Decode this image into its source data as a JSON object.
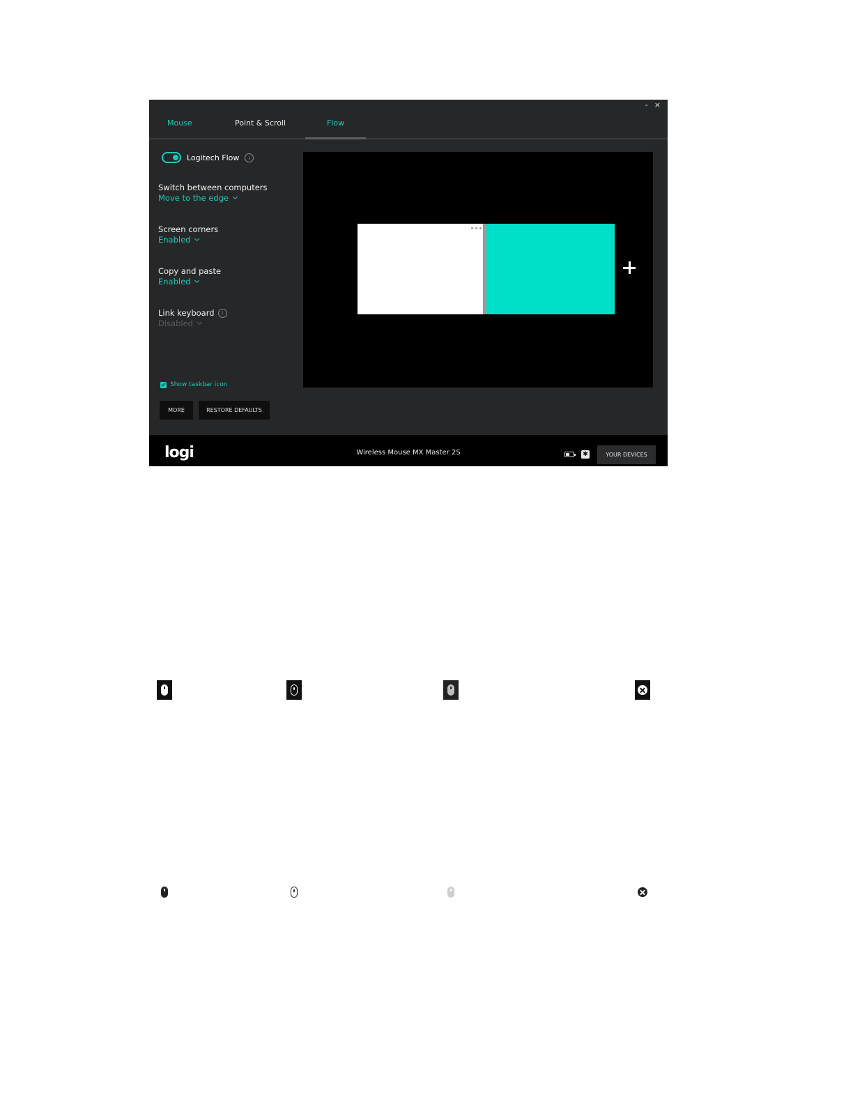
{
  "window": {
    "minimize_label": "-",
    "close_label": "×"
  },
  "tabs": [
    {
      "label": "Mouse"
    },
    {
      "label": "Point & Scroll"
    },
    {
      "label": "Flow"
    }
  ],
  "flow_panel": {
    "toggle_label": "Logitech Flow",
    "toggle_on": true,
    "info_glyph": "i",
    "settings": {
      "switch": {
        "title": "Switch between computers",
        "value": "Move to the edge"
      },
      "corners": {
        "title": "Screen corners",
        "value": "Enabled"
      },
      "copy": {
        "title": "Copy and paste",
        "value": "Enabled"
      },
      "link": {
        "title": "Link keyboard",
        "value": "Disabled"
      }
    },
    "show_taskbar_icon": {
      "label": "Show taskbar icon",
      "checked": true
    },
    "more_button": "MORE",
    "restore_button": "RESTORE DEFAULTS"
  },
  "footer": {
    "logo": "logi",
    "device_name": "Wireless Mouse MX Master 2S",
    "bluetooth_glyph": "✱",
    "your_devices_button": "YOUR DEVICES"
  },
  "colors": {
    "accent": "#1ac9b6",
    "screen_teal": "#00e0c8",
    "panel_bg": "#262728",
    "footer_bg": "#000000"
  },
  "icon_rows": [
    [
      "mouse-icon-dark-square",
      "mouse-outline-icon-dark-square",
      "mouse-icon-grey-square",
      "close-icon-dark-square"
    ],
    [
      "mouse-icon-dark",
      "mouse-outline-icon",
      "mouse-icon-light-grey",
      "close-icon-dark-circle"
    ]
  ]
}
